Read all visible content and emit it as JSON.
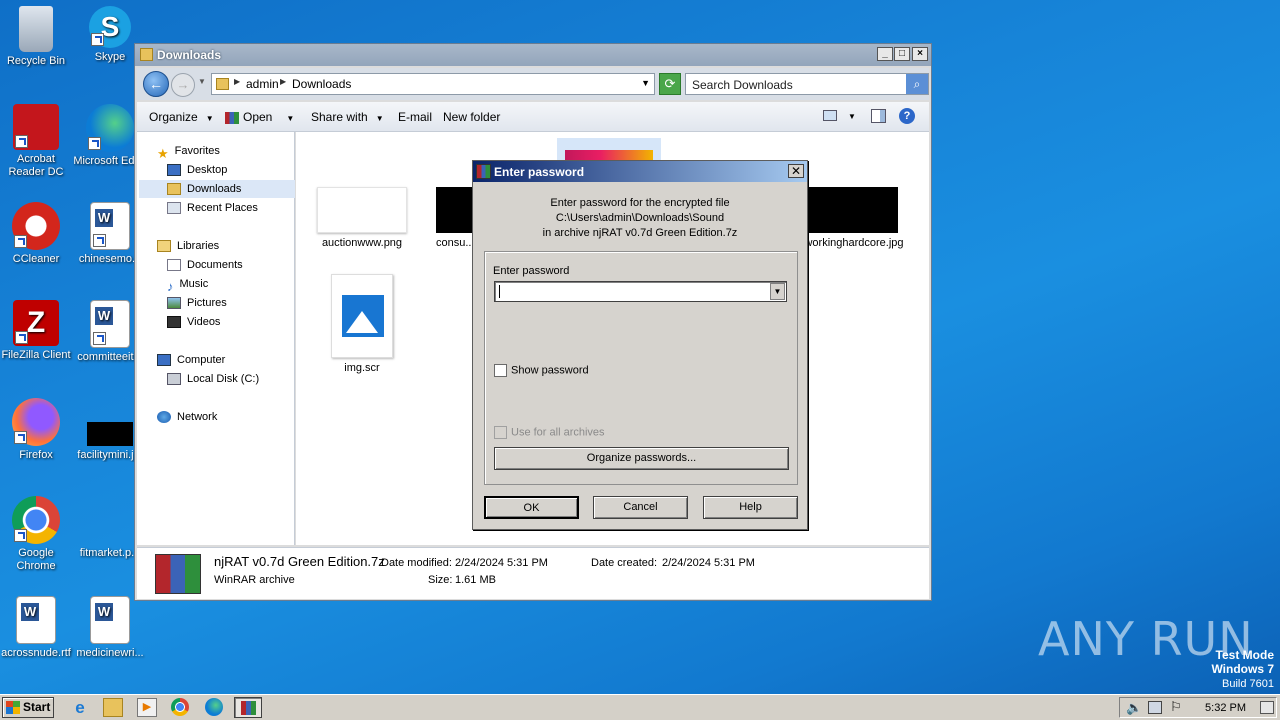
{
  "desktop": {
    "icons": [
      {
        "label": "Recycle Bin"
      },
      {
        "label": "Skype"
      },
      {
        "label": "Acrobat Reader DC"
      },
      {
        "label": "Microsoft Edge"
      },
      {
        "label": "CCleaner"
      },
      {
        "label": "chinesemo..."
      },
      {
        "label": "FileZilla Client"
      },
      {
        "label": "committeeit..."
      },
      {
        "label": "Firefox"
      },
      {
        "label": "facilitymini.j..."
      },
      {
        "label": "Google Chrome"
      },
      {
        "label": "fitmarket.p..."
      },
      {
        "label": "acrossnude.rtf"
      },
      {
        "label": "medicinewri..."
      }
    ],
    "watermark": {
      "logo": "ANY RUN",
      "line1": "Test Mode",
      "line2": "Windows 7",
      "line3": "Build 7601"
    }
  },
  "explorer": {
    "title": "Downloads",
    "breadcrumb": [
      "admin",
      "Downloads"
    ],
    "search_placeholder": "Search Downloads",
    "toolbar": {
      "organize": "Organize",
      "open": "Open",
      "share_with": "Share with",
      "email": "E-mail",
      "new_folder": "New folder"
    },
    "nav": {
      "favorites": "Favorites",
      "desktop": "Desktop",
      "downloads": "Downloads",
      "recent_places": "Recent Places",
      "libraries": "Libraries",
      "documents": "Documents",
      "music": "Music",
      "pictures": "Pictures",
      "videos": "Videos",
      "computer": "Computer",
      "local_disk": "Local Disk (C:)",
      "network": "Network"
    },
    "files": [
      {
        "name": "auctionwww.png"
      },
      {
        "name": "consu..."
      },
      {
        "name": "workinghardcore.jpg"
      },
      {
        "name": "img.scr"
      }
    ],
    "details": {
      "filename": "njRAT v0.7d Green Edition.7z",
      "type": "WinRAR archive",
      "date_modified_label": "Date modified:",
      "date_modified": "2/24/2024 5:31 PM",
      "date_created_label": "Date created:",
      "date_created": "2/24/2024 5:31 PM",
      "size_label": "Size:",
      "size": "1.61 MB"
    }
  },
  "dialog": {
    "title": "Enter password",
    "message_line1": "Enter password for the encrypted file",
    "message_line2": "C:\\Users\\admin\\Downloads\\Sound",
    "message_line3": "in archive njRAT v0.7d Green Edition.7z",
    "password_label": "Enter password",
    "password_value": "",
    "show_password": "Show password",
    "use_for_all": "Use for all archives",
    "organize_passwords": "Organize passwords...",
    "ok": "OK",
    "cancel": "Cancel",
    "help": "Help"
  },
  "taskbar": {
    "start": "Start",
    "clock": "5:32 PM"
  }
}
